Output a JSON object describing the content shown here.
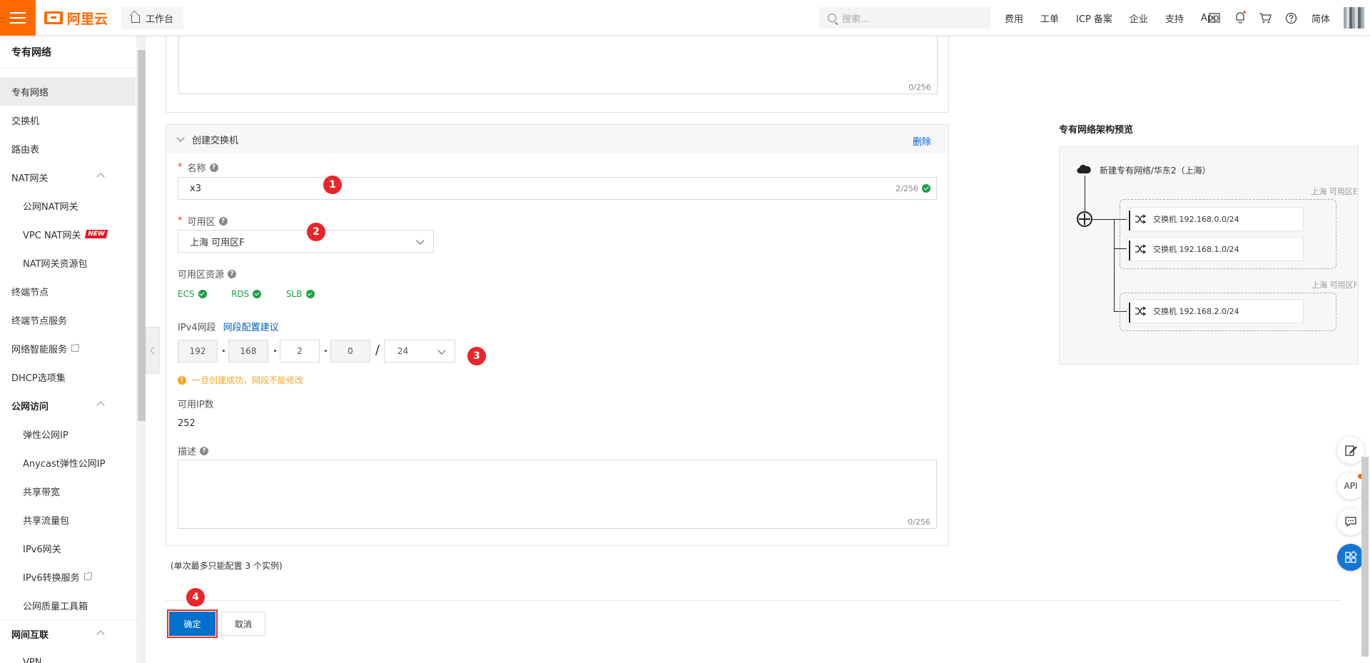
{
  "topbar": {
    "logo_text": "阿里云",
    "workbench_label": "工作台",
    "search_placeholder": "搜索...",
    "links": [
      "费用",
      "工单",
      "ICP 备案",
      "企业",
      "支持",
      "App"
    ],
    "lang": "简体",
    "icons": [
      "terminal-icon",
      "bell-icon",
      "cart-icon",
      "help-icon"
    ]
  },
  "sidebar": {
    "title": "专有网络",
    "items": [
      {
        "label": "专有网络",
        "type": "active"
      },
      {
        "label": "交换机",
        "type": "item"
      },
      {
        "label": "路由表",
        "type": "item"
      },
      {
        "label": "NAT网关",
        "type": "expand"
      },
      {
        "label": "公网NAT网关",
        "type": "sub"
      },
      {
        "label": "VPC NAT网关",
        "type": "sub",
        "badge": "NEW"
      },
      {
        "label": "NAT网关资源包",
        "type": "sub"
      },
      {
        "label": "终端节点",
        "type": "item"
      },
      {
        "label": "终端节点服务",
        "type": "item"
      },
      {
        "label": "网络智能服务",
        "type": "item",
        "external": true
      },
      {
        "label": "DHCP选项集",
        "type": "item"
      },
      {
        "label": "公网访问",
        "type": "group"
      },
      {
        "label": "弹性公网IP",
        "type": "sub"
      },
      {
        "label": "Anycast弹性公网IP",
        "type": "sub"
      },
      {
        "label": "共享带宽",
        "type": "sub"
      },
      {
        "label": "共享流量包",
        "type": "sub"
      },
      {
        "label": "IPv6网关",
        "type": "sub"
      },
      {
        "label": "IPv6转换服务",
        "type": "sub",
        "external": true
      },
      {
        "label": "公网质量工具箱",
        "type": "sub"
      },
      {
        "label": "网间互联",
        "type": "group"
      },
      {
        "label": "VPN",
        "type": "sub"
      }
    ]
  },
  "form": {
    "top_counter": "0/256",
    "section_title": "创建交换机",
    "delete_label": "删除",
    "name_label": "名称",
    "name_value": "x3",
    "name_counter": "2/256",
    "zone_label": "可用区",
    "zone_value": "上海 可用区F",
    "zone_resources_label": "可用区资源",
    "resources": [
      "ECS",
      "RDS",
      "SLB"
    ],
    "ipv4_label": "IPv4网段",
    "ipv4_link": "网段配置建议",
    "ip_octets": [
      "192",
      "168",
      "2",
      "0"
    ],
    "ip_slash": "/",
    "ip_mask": "24",
    "warning": "一旦创建成功，网段不能修改",
    "available_ip_label": "可用IP数",
    "available_ip_value": "252",
    "desc_label": "描述",
    "desc_counter": "0/256",
    "note": "(单次最多只能配置 3 个实例)",
    "confirm_label": "确定",
    "cancel_label": "取消"
  },
  "markers": [
    "1",
    "2",
    "3",
    "4"
  ],
  "preview": {
    "title": "专有网络架构预览",
    "vpc_label": "新建专有网络/华东2（上海）",
    "zones": [
      {
        "label": "上海 可用区E",
        "switches": [
          "交换机 192.168.0.0/24",
          "交换机 192.168.1.0/24"
        ]
      },
      {
        "label": "上海 可用区F",
        "switches": [
          "交换机 192.168.2.0/24"
        ]
      }
    ]
  },
  "float_tools": [
    "edit-icon",
    "API",
    "chat-icon",
    "apps-icon"
  ],
  "colors": {
    "accent": "#ff6a00",
    "primary": "#0070cc",
    "success": "#1e9e45",
    "warning": "#f5a623",
    "marker": "#e8262a"
  }
}
